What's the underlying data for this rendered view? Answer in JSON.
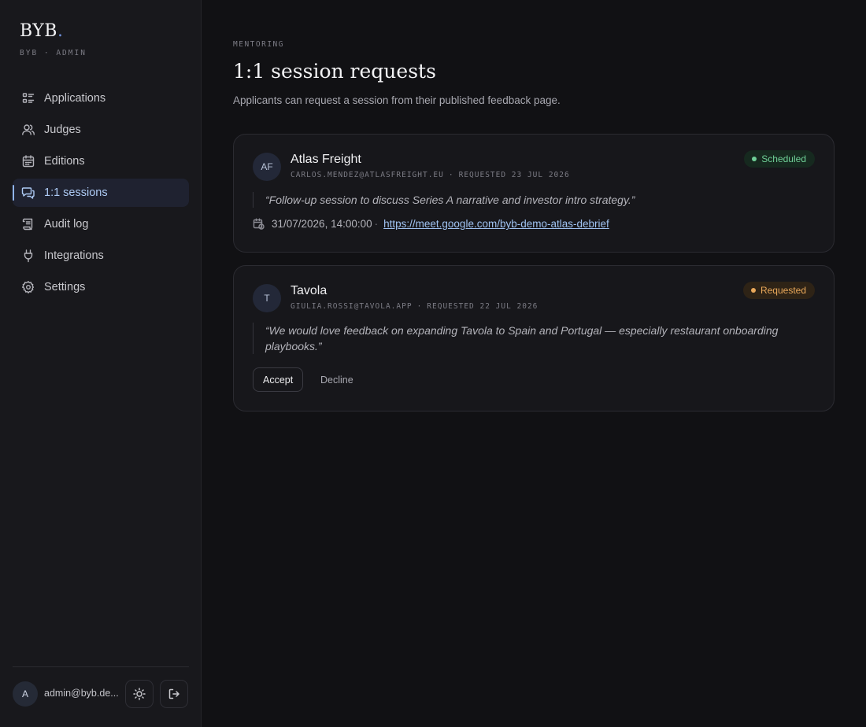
{
  "brand": {
    "logo": "BYB",
    "logo_dot": ".",
    "subtitle": "BYB · ADMIN"
  },
  "sidebar": {
    "items": [
      {
        "label": "Applications",
        "icon": "list-icon",
        "active": false
      },
      {
        "label": "Judges",
        "icon": "users-icon",
        "active": false
      },
      {
        "label": "Editions",
        "icon": "calendar-icon",
        "active": false
      },
      {
        "label": "1:1 sessions",
        "icon": "chat-icon",
        "active": true
      },
      {
        "label": "Audit log",
        "icon": "scroll-icon",
        "active": false
      },
      {
        "label": "Integrations",
        "icon": "plug-icon",
        "active": false
      },
      {
        "label": "Settings",
        "icon": "gear-icon",
        "active": false
      }
    ],
    "user": {
      "initial": "A",
      "email": "admin@byb.de..."
    }
  },
  "header": {
    "eyebrow": "MENTORING",
    "title": "1:1 session requests",
    "subtitle": "Applicants can request a session from their published feedback page."
  },
  "sessions": [
    {
      "initials": "AF",
      "name": "Atlas Freight",
      "email": "CARLOS.MENDEZ@ATLASFREIGHT.EU",
      "requested": "REQUESTED 23 JUL 2026",
      "status": "Scheduled",
      "quote": "“Follow-up session to discuss Series A narrative and investor intro strategy.”",
      "scheduled_at": "31/07/2026, 14:00:00",
      "meet_link": "https://meet.google.com/byb-demo-atlas-debrief"
    },
    {
      "initials": "T",
      "name": "Tavola",
      "email": "GIULIA.ROSSI@TAVOLA.APP",
      "requested": "REQUESTED 22 JUL 2026",
      "status": "Requested",
      "quote": "“We would love feedback on expanding Tavola to Spain and Portugal — especially restaurant onboarding playbooks.”",
      "accept_label": "Accept",
      "decline_label": "Decline"
    }
  ],
  "colors": {
    "accent": "#8fb4ef",
    "scheduled": "#6fcf97",
    "requested": "#e9a85a",
    "background": "#111114",
    "sidebar": "#18181c"
  }
}
